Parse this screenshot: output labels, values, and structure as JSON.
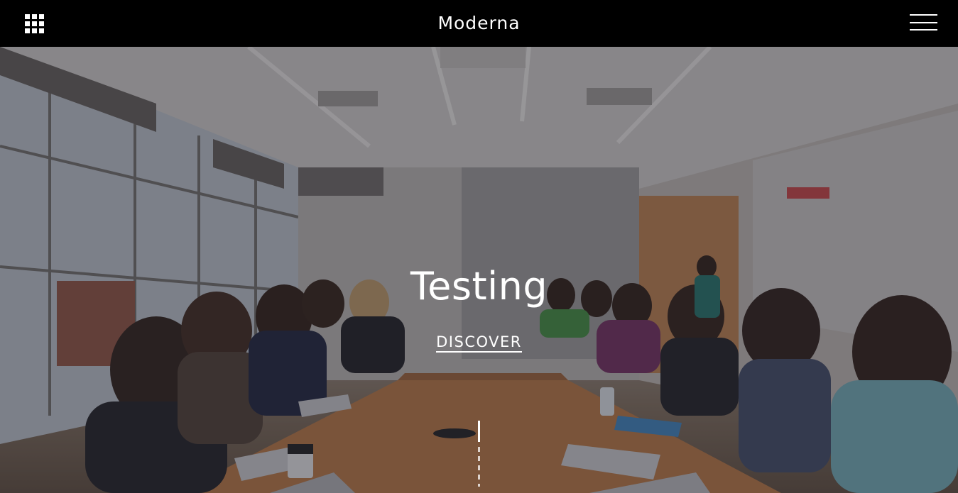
{
  "header": {
    "brand": "Moderna",
    "apps_icon": "grid-icon",
    "menu_icon": "hamburger-menu-icon"
  },
  "hero": {
    "title": "Testing",
    "cta_label": "DISCOVER",
    "background": "conference-room-photo",
    "scroll_indicator": "scroll-down-indicator"
  }
}
